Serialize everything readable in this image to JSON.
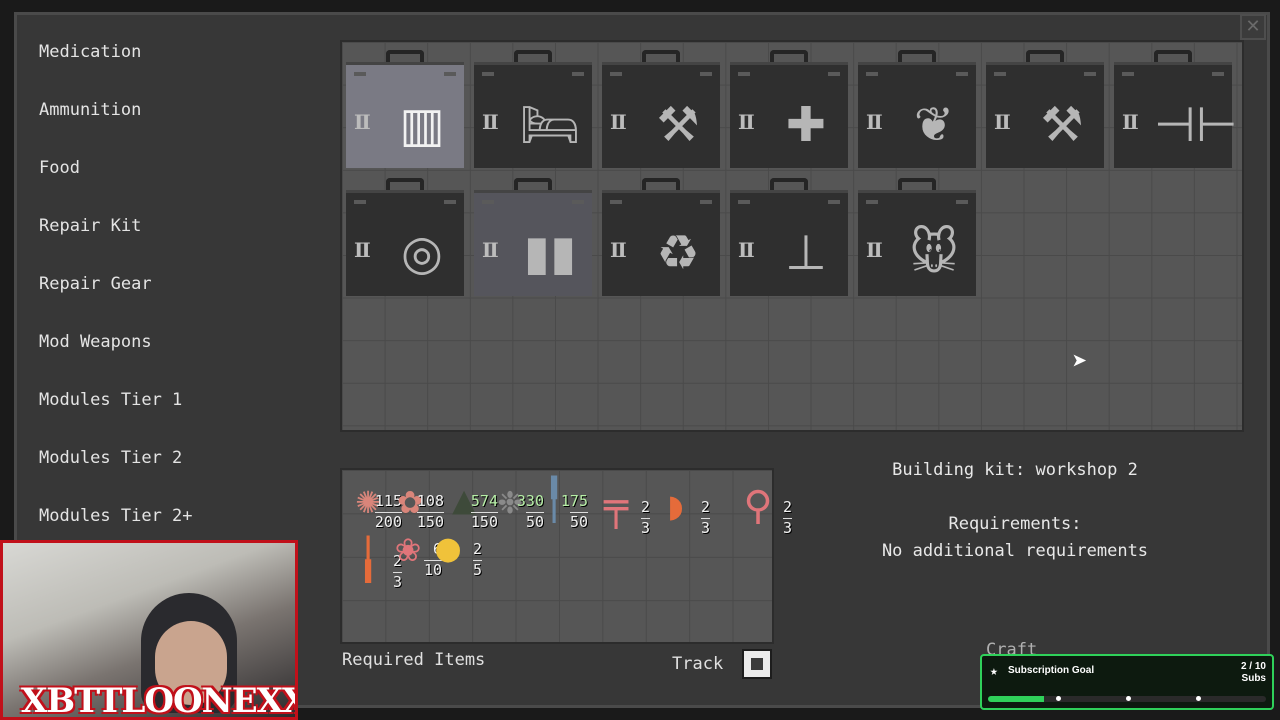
{
  "sidebar": {
    "items": [
      {
        "label": "Medication"
      },
      {
        "label": "Ammunition"
      },
      {
        "label": "Food"
      },
      {
        "label": "Repair Kit"
      },
      {
        "label": "Repair Gear"
      },
      {
        "label": "Mod Weapons"
      },
      {
        "label": "Modules Tier 1"
      },
      {
        "label": "Modules Tier 2"
      },
      {
        "label": "Modules Tier 2+"
      }
    ]
  },
  "close_button": {
    "symbol": "✕",
    "icon": "close-icon"
  },
  "kits": [
    {
      "tier": "II",
      "icon": "storage-crate-icon",
      "glyph": "▥",
      "state": "selected"
    },
    {
      "tier": "II",
      "icon": "bed-icon",
      "glyph": "🛏",
      "state": "normal"
    },
    {
      "tier": "II",
      "icon": "workbench-icon",
      "glyph": "⚒",
      "state": "normal"
    },
    {
      "tier": "II",
      "icon": "medical-bed-icon",
      "glyph": "✚",
      "state": "normal"
    },
    {
      "tier": "II",
      "icon": "plant-hands-icon",
      "glyph": "❦",
      "state": "normal"
    },
    {
      "tier": "II",
      "icon": "tools-icon",
      "glyph": "⚒",
      "state": "normal"
    },
    {
      "tier": "II",
      "icon": "dumbbell-icon",
      "glyph": "⊣⊢",
      "state": "normal"
    },
    {
      "tier": "II",
      "icon": "target-icon",
      "glyph": "◎",
      "state": "normal"
    },
    {
      "tier": "II",
      "icon": "ammo-icon",
      "glyph": "▮▮",
      "state": "hover"
    },
    {
      "tier": "II",
      "icon": "recycle-icon",
      "glyph": "♻",
      "state": "normal"
    },
    {
      "tier": "II",
      "icon": "anvil-icon",
      "glyph": "⊥",
      "state": "normal"
    },
    {
      "tier": "II",
      "icon": "mouse-icon",
      "glyph": "🐭",
      "state": "normal"
    }
  ],
  "requirements_panel": {
    "items": [
      {
        "icon": "pink-ore-icon",
        "glyph": "✺",
        "color": "#d9857a",
        "have": "115",
        "need": "200",
        "ok": false
      },
      {
        "icon": "pink-brain-icon",
        "glyph": "✿",
        "color": "#d9857a",
        "have": "108",
        "need": "150",
        "ok": false
      },
      {
        "icon": "scrap-pile-icon",
        "glyph": "▲",
        "color": "#3e4a3a",
        "have": "574",
        "need": "150",
        "ok": true
      },
      {
        "icon": "wire-bundle-icon",
        "glyph": "❉",
        "color": "#8a8a8a",
        "have": "330",
        "need": "50",
        "ok": true
      },
      {
        "icon": "pencil-icon",
        "glyph": "╿",
        "color": "#6a8aa8",
        "have": "175",
        "need": "50",
        "ok": true
      },
      {
        "icon": "pink-hammer-icon",
        "glyph": "╤",
        "color": "#e0757a",
        "have": "2",
        "need": "3",
        "ok": false
      },
      {
        "icon": "orange-drill-icon",
        "glyph": "◗",
        "color": "#e56b3a",
        "have": "2",
        "need": "3",
        "ok": false
      },
      {
        "icon": "pink-wrench-icon",
        "glyph": "⚲",
        "color": "#e0757a",
        "have": "2",
        "need": "3",
        "ok": false
      },
      {
        "icon": "orange-screwdriver-icon",
        "glyph": "╽",
        "color": "#e56b3a",
        "have": "2",
        "need": "3",
        "ok": false
      },
      {
        "icon": "pink-coil-icon",
        "glyph": "❀",
        "color": "#e0757a",
        "have": "6",
        "need": "10",
        "ok": false
      },
      {
        "icon": "yellow-bulb-icon",
        "glyph": "●",
        "color": "#f0c23a",
        "have": "2",
        "need": "5",
        "ok": false
      }
    ],
    "label": "Required Items",
    "track_label": "Track"
  },
  "info": {
    "title": "Building kit: workshop 2",
    "requirements_heading": "Requirements:",
    "requirements_text": "No additional requirements",
    "craft_label": "Craft"
  },
  "cursor": {
    "icon": "mouse-cursor-icon",
    "glyph": "➤"
  },
  "webcam": {
    "streamer_name": "XBTTLOONEXX"
  },
  "sub_goal": {
    "title": "Subscription Goal",
    "count": "2 / 10",
    "unit": "Subs",
    "progress": 0.2,
    "accent": "#2fd15a"
  },
  "colors": {
    "background": "#373737",
    "grid": "#565656",
    "text": "#e4e4e4",
    "stream_accent": "#c1101a"
  }
}
